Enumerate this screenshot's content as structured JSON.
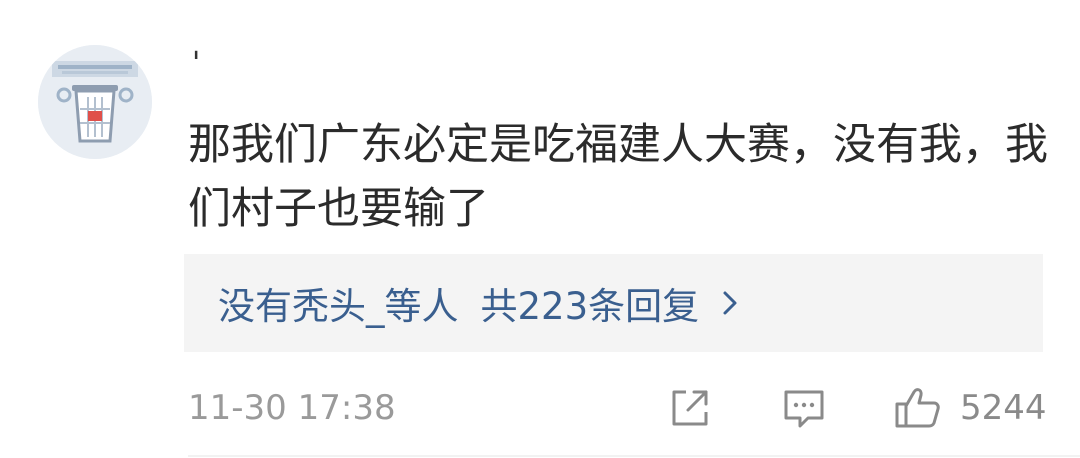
{
  "comment": {
    "username": "'",
    "avatar_icon": "recycle-bin-icon",
    "text": "那我们广东必定是吃福建人大赛，没有我，我们村子也要输了",
    "replies": {
      "users": "没有秃头_等人",
      "count_text": "共223条回复"
    },
    "timestamp": "11-30 17:38",
    "actions": {
      "share_icon": "share-icon",
      "comment_icon": "comment-icon",
      "like_icon": "thumbs-up-icon",
      "like_count": "5244"
    }
  },
  "colors": {
    "link": "#3a5f8f",
    "text": "#2b2b2b",
    "meta": "#9a9a9a",
    "reply_bg": "#f4f4f4"
  }
}
